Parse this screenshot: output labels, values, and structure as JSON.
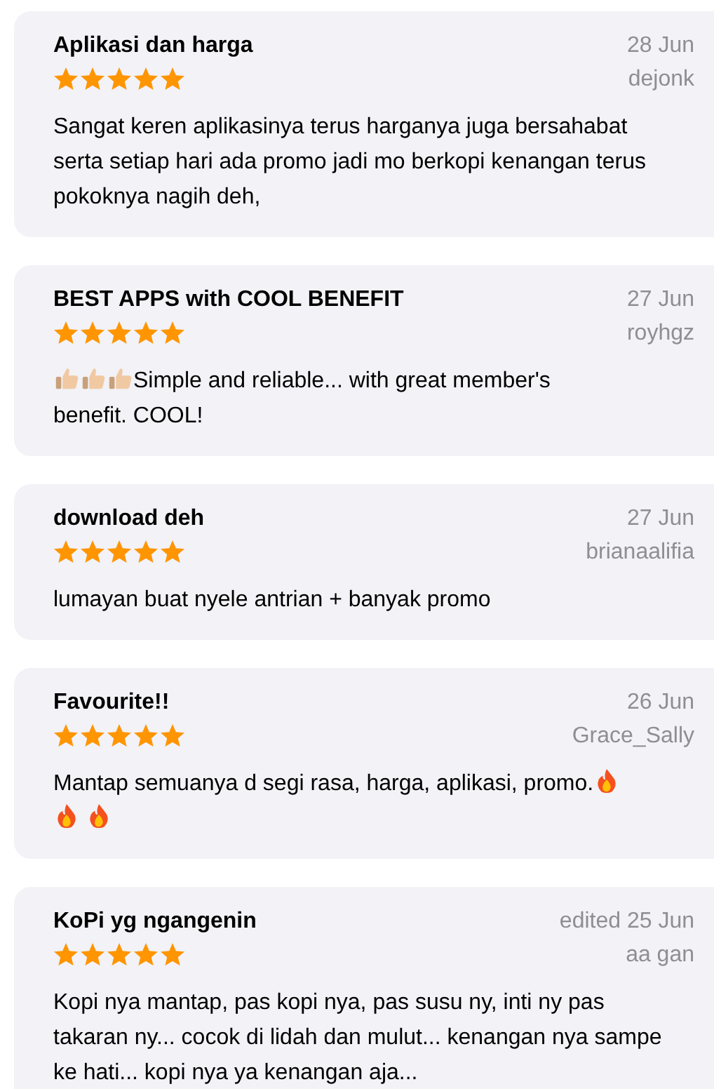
{
  "reviews": [
    {
      "title": "Aplikasi dan harga",
      "date": "28 Jun",
      "author": "dejonk",
      "stars": 5,
      "body": [
        [
          {
            "kind": "text",
            "text": "Sangat keren aplikasinya terus harganya juga bersahabat serta setiap hari ada promo jadi mo berkopi kenangan terus pokoknya nagih deh,"
          }
        ]
      ]
    },
    {
      "title": "BEST APPS with COOL BENEFIT",
      "date": "27 Jun",
      "author": "royhgz",
      "stars": 5,
      "body": [
        [
          {
            "kind": "thumbs"
          },
          {
            "kind": "thumbs"
          },
          {
            "kind": "thumbs"
          },
          {
            "kind": "text",
            "text": "Simple and reliable... with great member's"
          }
        ],
        [
          {
            "kind": "text",
            "text": "benefit. COOL!"
          }
        ]
      ]
    },
    {
      "title": "download deh",
      "date": "27 Jun",
      "author": "brianaalifia",
      "stars": 5,
      "body": [
        [
          {
            "kind": "text",
            "text": "lumayan buat nyele antrian + banyak promo"
          }
        ]
      ]
    },
    {
      "title": "Favourite!!",
      "date": "26 Jun",
      "author": "Grace_Sally",
      "stars": 5,
      "body": [
        [
          {
            "kind": "text",
            "text": "Mantap semuanya d segi rasa, harga, aplikasi, promo."
          },
          {
            "kind": "fire"
          }
        ],
        [
          {
            "kind": "fire"
          },
          {
            "kind": "fire"
          }
        ]
      ]
    },
    {
      "title": "KoPi yg ngangenin",
      "date": "edited 25 Jun",
      "author": "aa gan",
      "stars": 5,
      "body": [
        [
          {
            "kind": "text",
            "text": "Kopi nya mantap, pas kopi nya, pas susu ny, inti ny pas takaran ny... cocok di lidah dan mulut... kenangan nya sampe ke hati... kopi nya ya kenangan aja..."
          }
        ]
      ]
    }
  ]
}
